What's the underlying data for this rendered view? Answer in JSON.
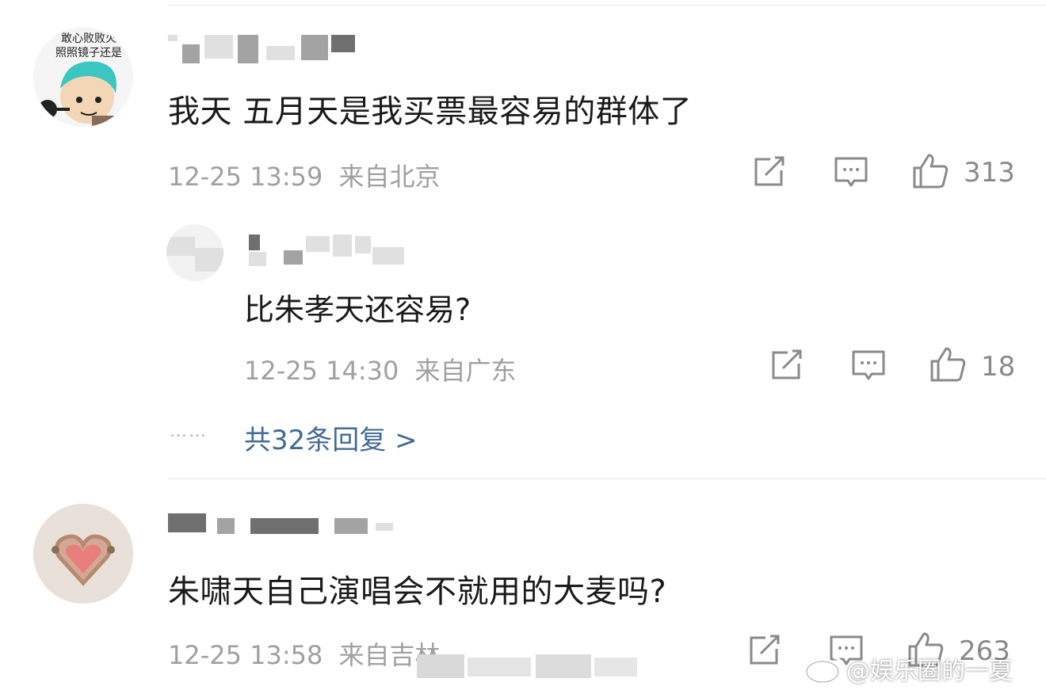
{
  "comments": [
    {
      "avatar_caption_lines": [
        "敢心败败火",
        "照照镜子还是"
      ],
      "text": "我天 五月天是我买票最容易的群体了",
      "timestamp": "12-25 13:59",
      "location": "来自北京",
      "likes": "313"
    },
    {
      "text": "朱啸天自己演唱会不就用的大麦吗?",
      "timestamp": "12-25 13:58",
      "location": "来自吉林",
      "likes": "263"
    }
  ],
  "reply": {
    "text": "比朱孝天还容易?",
    "timestamp": "12-25 14:30",
    "location": "来自广东",
    "likes": "18"
  },
  "more_replies": {
    "dots": "……",
    "label": "共32条回复 >"
  },
  "watermark": {
    "text": "@娱乐圈的一夏",
    "icon": "weibo-logo"
  },
  "icons": [
    "share-icon",
    "comment-icon",
    "like-icon",
    "chevron-right-icon"
  ]
}
